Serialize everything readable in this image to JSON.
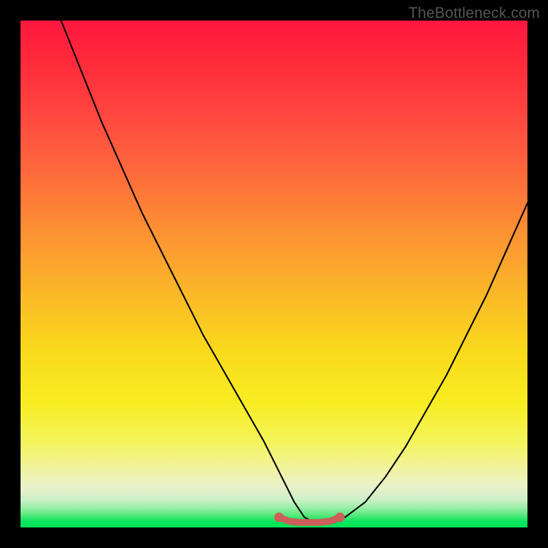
{
  "watermark": "TheBottleneck.com",
  "chart_data": {
    "type": "line",
    "title": "",
    "xlabel": "",
    "ylabel": "",
    "xlim": [
      0,
      100
    ],
    "ylim": [
      0,
      100
    ],
    "series": [
      {
        "name": "black-curve",
        "color": "#000000",
        "x": [
          8,
          12,
          16,
          20,
          24,
          28,
          32,
          36,
          40,
          44,
          48,
          50,
          52,
          54,
          56,
          58,
          60,
          62,
          64,
          68,
          72,
          76,
          80,
          84,
          88,
          92,
          96,
          100
        ],
        "values": [
          100,
          90,
          80,
          71,
          62,
          54,
          46,
          38,
          31,
          24,
          17,
          13,
          9,
          5,
          2,
          1,
          1,
          1,
          2,
          5,
          10,
          16,
          23,
          30,
          38,
          46,
          55,
          64
        ]
      },
      {
        "name": "red-highlight",
        "color": "#cc5f5a",
        "x": [
          51,
          53,
          55,
          57,
          59,
          61,
          63
        ],
        "values": [
          2.0,
          1.2,
          1.0,
          1.0,
          1.0,
          1.2,
          2.0
        ]
      }
    ],
    "highlight_endpoints": {
      "color": "#cc5f5a",
      "points": [
        {
          "x": 51,
          "y": 2.0
        },
        {
          "x": 63,
          "y": 2.0
        }
      ]
    }
  }
}
